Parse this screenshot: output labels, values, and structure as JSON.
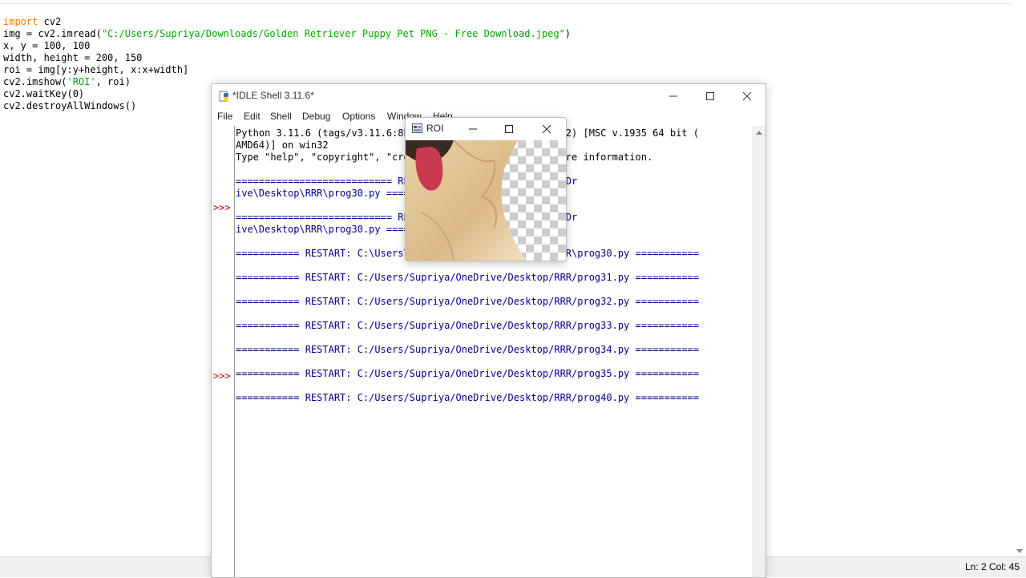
{
  "editor": {
    "code_lines": [
      "import cv2",
      "img = cv2.imread(\"C:/Users/Supriya/Downloads/Golden Retriever Puppy Pet PNG - Free Download.jpeg\")",
      "x, y = 100, 100",
      "width, height = 200, 150",
      "roi = img[y:y+height, x:x+width]",
      "cv2.imshow('ROI', roi)",
      "cv2.waitKey(0)",
      "cv2.destroyAllWindows()"
    ],
    "status": "Ln: 2  Col: 45"
  },
  "shell": {
    "title": "*IDLE Shell 3.11.6*",
    "menu": [
      "File",
      "Edit",
      "Shell",
      "Debug",
      "Options",
      "Window",
      "Help"
    ],
    "prompt": ">>>",
    "lines": [
      "Python 3.11.6 (tags/v3.11.6:8b6ee5b, Oct  2 2023, 14:57:12) [MSC v.1935 64 bit (",
      "AMD64)] on win32",
      "Type \"help\", \"copyright\", \"credits\" or \"license()\" for more information.",
      "",
      "=========================== RESTART: C:\\Users\\Supriya\\OneDr",
      "ive\\Desktop\\RRR\\prog30.py ===========================",
      "",
      "=========================== RESTART: C:\\Users\\Supriya\\OneDr",
      "ive\\Desktop\\RRR\\prog30.py ===========================",
      "",
      "=========== RESTART: C:\\Users\\Supriya\\OneDrive\\Desktop\\RRR\\prog30.py ===========",
      "",
      "=========== RESTART: C:/Users/Supriya/OneDrive/Desktop/RRR/prog31.py ===========",
      "",
      "=========== RESTART: C:/Users/Supriya/OneDrive/Desktop/RRR/prog32.py ===========",
      "",
      "=========== RESTART: C:/Users/Supriya/OneDrive/Desktop/RRR/prog33.py ===========",
      "",
      "=========== RESTART: C:/Users/Supriya/OneDrive/Desktop/RRR/prog34.py ===========",
      "",
      "=========== RESTART: C:/Users/Supriya/OneDrive/Desktop/RRR/prog35.py ===========",
      "",
      "=========== RESTART: C:/Users/Supriya/OneDrive/Desktop/RRR/prog40.py ==========="
    ]
  },
  "roi": {
    "title": "ROI"
  },
  "icons": {
    "minimize": "minimize-icon",
    "maximize": "maximize-icon",
    "close": "close-icon"
  }
}
